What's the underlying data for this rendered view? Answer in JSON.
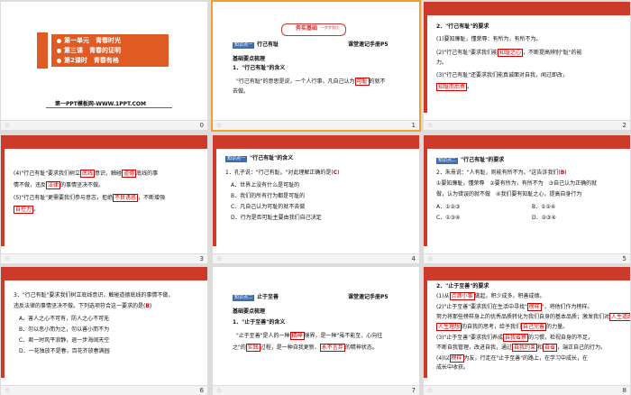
{
  "slide_numbers": [
    "0",
    "1",
    "2",
    "3",
    "4",
    "5",
    "6",
    "7",
    "8"
  ],
  "star_glyph": "☆",
  "s0": {
    "line1": "第一单元　青春时光",
    "line2": "第三课　青春的证明",
    "line3": "第2课时　青春有格",
    "footer": "第一PPT模板网-WWW.1PPT.COM"
  },
  "s1": {
    "badge": "务实基础",
    "badge_sub": "一步步到位",
    "tag": "知识点一",
    "section_title": "行己有耻",
    "ref": "课堂速记手册P5",
    "subhead": "基础要点梳理",
    "q1": "1．\"行己有耻\"的含义",
    "line1": "\"行己有耻\"的意思是说，一个人行事，凡自己认为",
    "blank1": "可耻",
    "line1b": "的就不",
    "line2": "去做。"
  },
  "s2": {
    "title": "2．\"行己有耻\"的要求",
    "l1": "(1)要知廉耻，懂荣辱：有所为，有所不为。",
    "l2a": "(2)\"行己有耻\"要求我们能",
    "blank1": "知耻之心",
    "l2b": "，不断提高辨别\"耻\"的能",
    "l3": "力。",
    "l4": "(3)\"行己有耻\"还要求我们能真诚面对自我，闻过即改，",
    "blank2": "知耻而后勇",
    "l4b": "。"
  },
  "s3": {
    "l1a": "(4)\"行己有耻\"要求我们树立",
    "blank1": "底线",
    "l1b": "意识，触碰",
    "blank2": "道德",
    "l1c": "底线的事",
    "l2a": "情不做，违反",
    "blank3": "法律",
    "l2b": "的事情坚决不做。",
    "l3a": "(5)\"行己有耻\"更需要我们参与意志，拒绝",
    "blank4": "不良诱惑",
    "l3b": "，不断增强",
    "blank5": "自控力",
    "l4": "。"
  },
  "s4": {
    "tag": "知识点一",
    "title": "\"行己有耻\"的含义",
    "q": "1．孔子说：\"行己有耻。\"对此理解正确的是(",
    "answer": "C",
    "q_end": ")",
    "opts": [
      "A．世界上没有什么是可耻的",
      "B．我们的所有行为都是可耻的",
      "C．凡自己认为可耻的就不去做",
      "D．行为是否可耻主要由我们自己决定"
    ]
  },
  "s5": {
    "tag": "知识点二",
    "title": "\"行己有耻\"的要求",
    "q1": "2．朱熹说：\"人有耻，则能有所不为。\"这告诉我们(",
    "answer": "B",
    "q1_end": ")",
    "l1": "①要知廉耻，懂荣辱　②要有所为，有所不为　③自己认为正确的就",
    "l2": "做，认为错误的就不做　④我们要有知耻之心，提高自身行为",
    "opts": [
      "A．①②③",
      "B．①②④",
      "C．①③④",
      "D．②③④"
    ]
  },
  "s6": {
    "l1": "3．\"行己有耻\"要求我们树立底线意识，触碰道德底线的事情不做，",
    "l2a": "违反法律的事情坚决不做。下列选项符合这一要求的是(",
    "answer": "B",
    "l2b": ")",
    "opts": [
      "A．害人之心不可有，防人之心不可无",
      "B．勿以恶小而为之，勿以善小而不为",
      "C．君一时风平浪静，退一步海阔天空",
      "D．一花独放不是春，百花齐放春满园"
    ]
  },
  "s7": {
    "tag": "知识点二",
    "section_title": "止于至善",
    "ref": "课堂速记手册P5",
    "subhead": "基础要点梳理",
    "q1": "1．\"止于至善\"的含义",
    "l1a": "\"止于至善\"是人的一种",
    "blank1": "精神",
    "l1b": "境界，是一种\"虽不能至，心向往",
    "l2a": "之\"的",
    "blank2": "实践",
    "l2b": "过程，是一种自我更新、",
    "blank3": "永不言弃",
    "l2c": "的精神状态。"
  },
  "s8": {
    "title": "2．\"止于至善\"的要求",
    "l1a": "(1)从",
    "blank1": "点滴小事",
    "l1b": "做起，积少成多，积善成德。",
    "l2a": "(2)\"止于至善\"要求我们在生活中寻找\"",
    "blank2": "榜样",
    "l2b": "\"，将他们作为榜样。",
    "l3a": "努力将那些榜样身上的优秀品质转化为我们自身的基本品质；激发我们对",
    "blank3": "人生道路",
    "l4a": "的自我",
    "blank4": "人生理想",
    "l4b": "的思考，给予我们",
    "blank5": "自己完善",
    "l4c": "的力量。",
    "l5a": "(3)\"止于至善\"要求我们养成",
    "blank6": "自我省察",
    "l5b": "的习惯，检视自身的不足，",
    "l6a": "不断自我管理，改进自我，通过",
    "blank7": "自我约束",
    "l6b": "和",
    "blank8": "自省",
    "l6c": "，端正自己的行为。",
    "l7a": "(4)以",
    "blank9": "榜样",
    "l7b": "为友，行走在\"止于至善\"的路上，在学习中成长，在",
    "l8": "成长中收获。"
  }
}
